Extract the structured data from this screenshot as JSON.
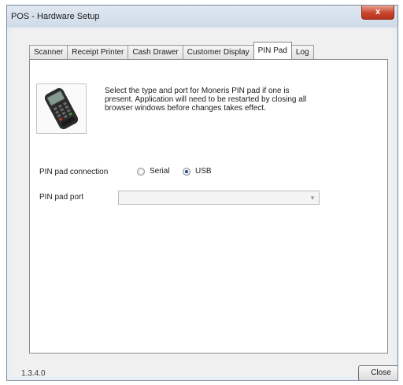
{
  "window": {
    "title": "POS - Hardware Setup",
    "close_glyph": "x"
  },
  "tabs": [
    {
      "label": "Scanner"
    },
    {
      "label": "Receipt Printer"
    },
    {
      "label": "Cash Drawer"
    },
    {
      "label": "Customer Display"
    },
    {
      "label": "PIN Pad"
    },
    {
      "label": "Log"
    }
  ],
  "active_tab": "PIN Pad",
  "pin_pad": {
    "description": "Select the type and port for Moneris PIN pad if one is present. Application will need to be restarted by closing all browser windows before changes takes effect.",
    "connection_label": "PIN pad connection",
    "connection_options": [
      {
        "label": "Serial",
        "checked": false
      },
      {
        "label": "USB",
        "checked": true
      }
    ],
    "port_label": "PIN pad port",
    "port_value": "",
    "device_icon": "pin-pad-terminal-icon"
  },
  "footer": {
    "version": "1.3.4.0",
    "close_label": "Close"
  },
  "colors": {
    "title_close_red": "#c8452f",
    "selected_radio": "#1f4f8f"
  }
}
